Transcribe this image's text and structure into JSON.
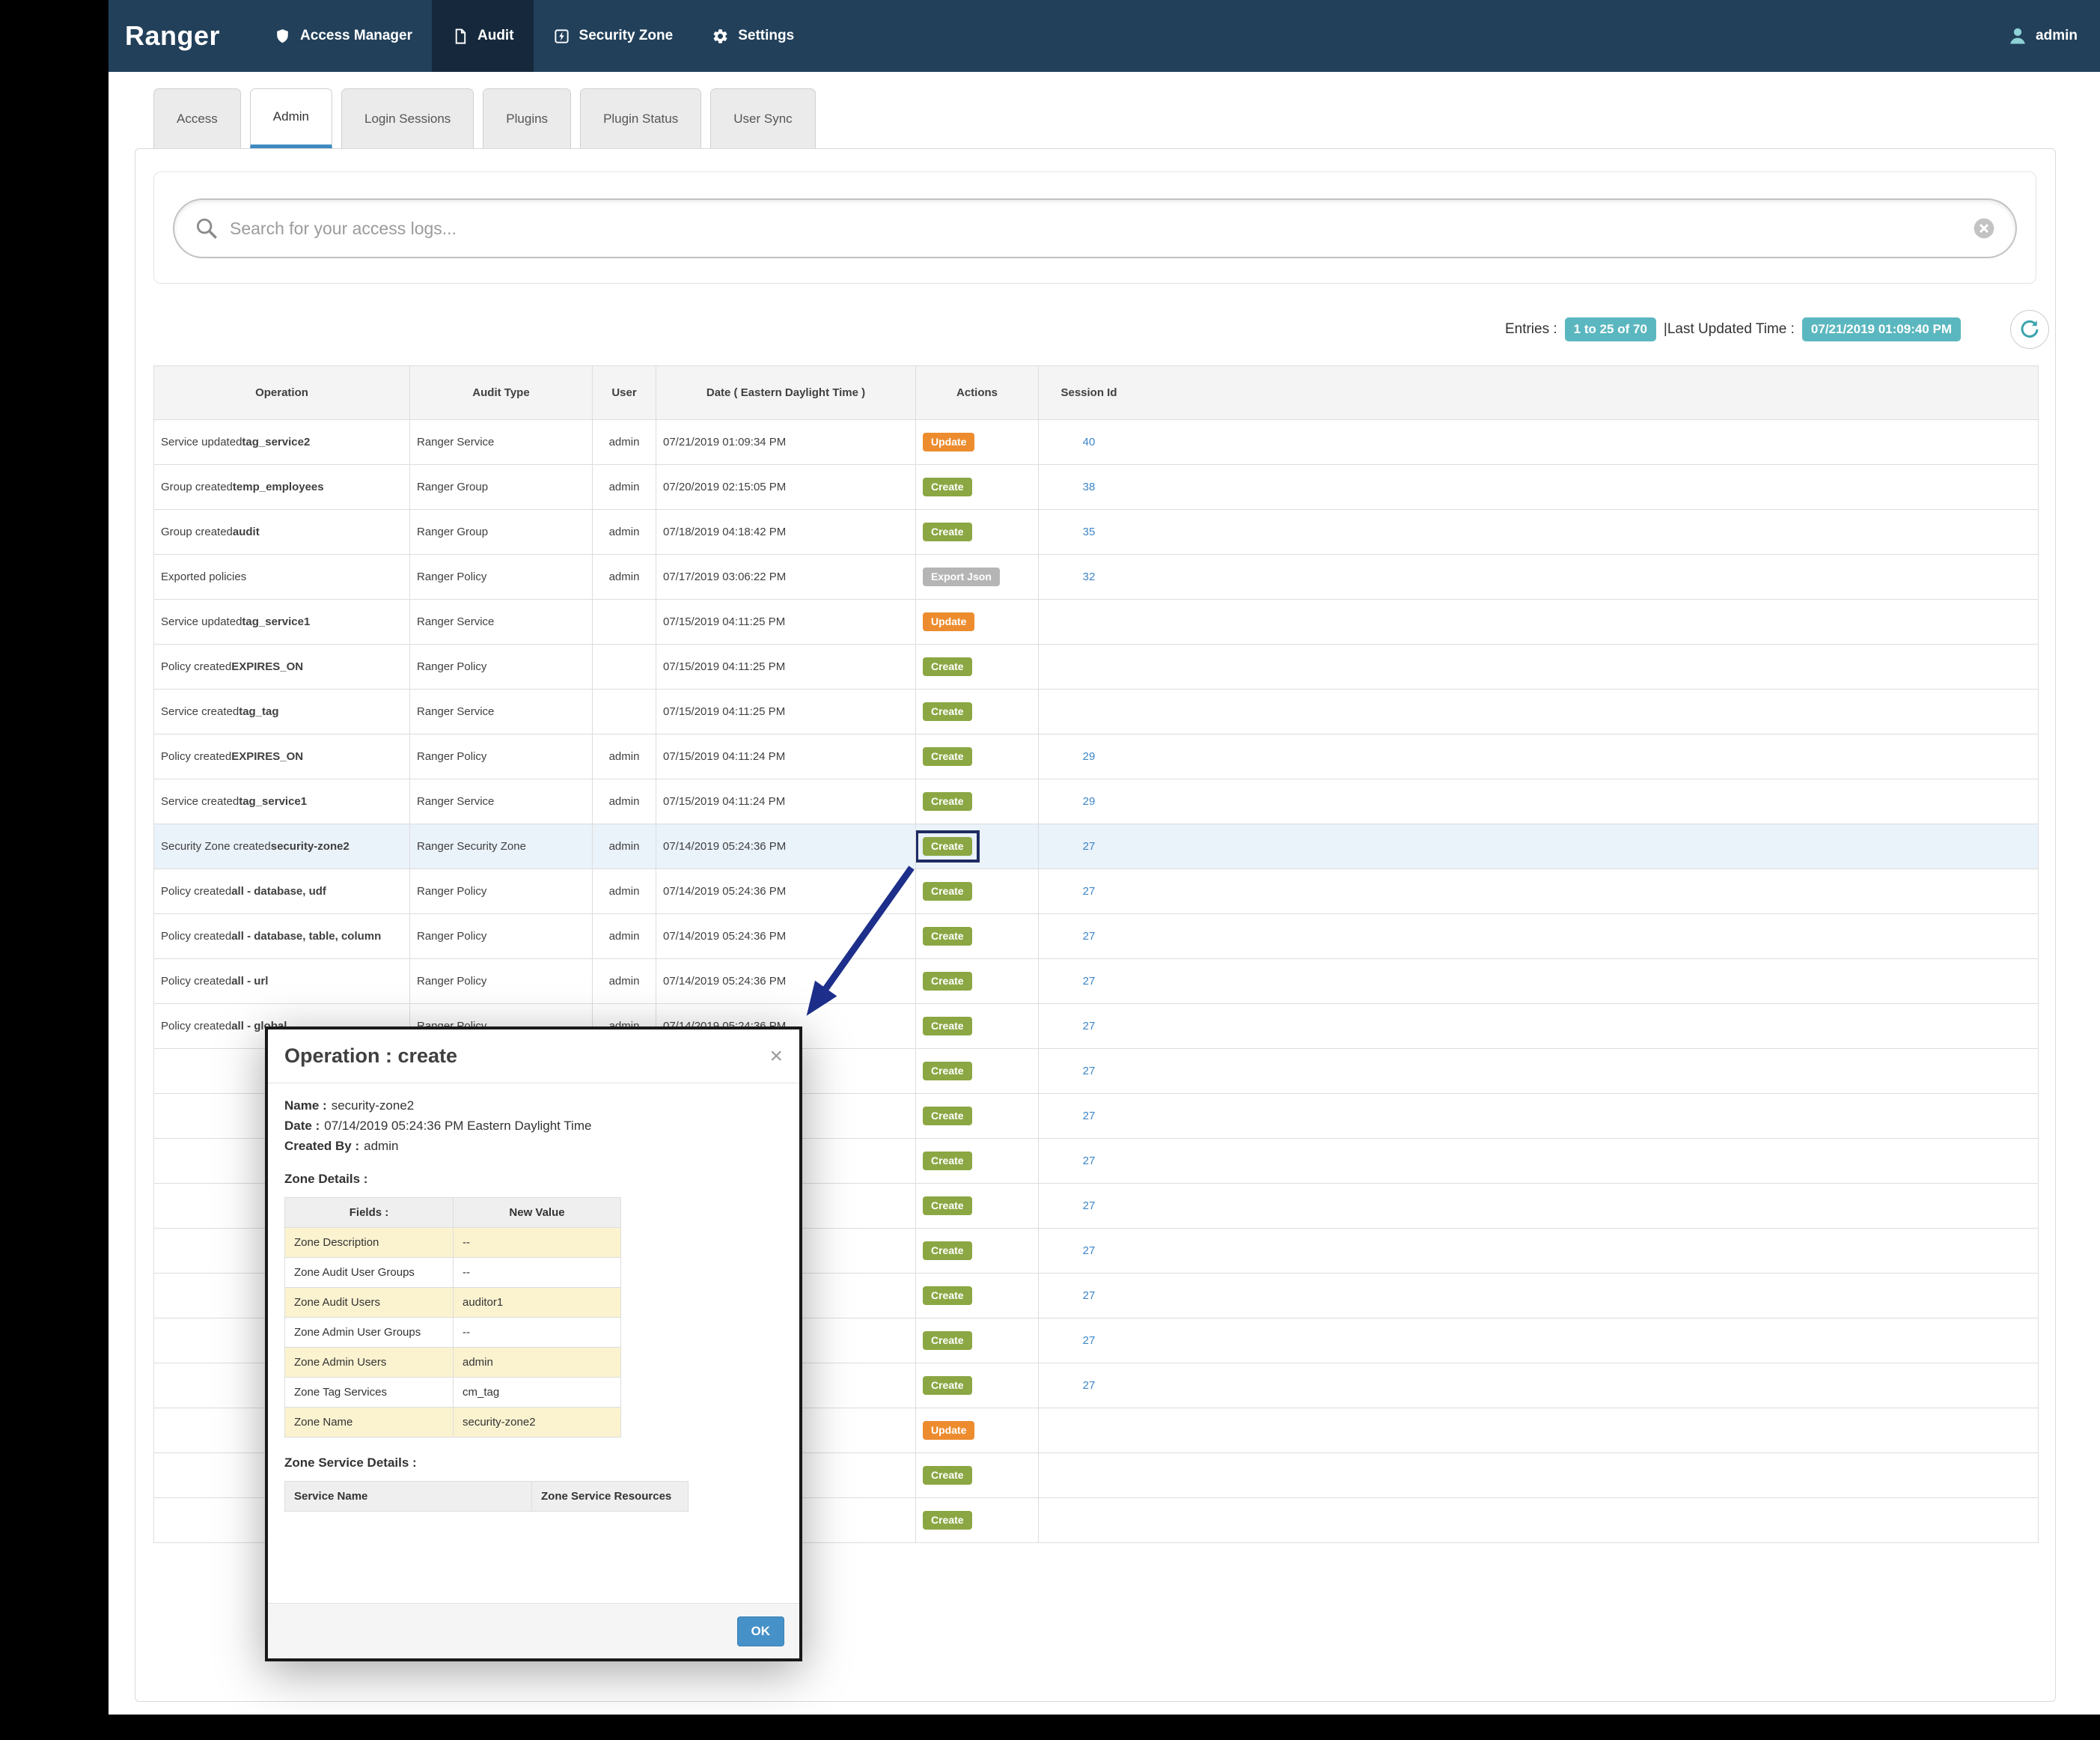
{
  "navbar": {
    "brand": "Ranger",
    "items": [
      {
        "id": "access-manager",
        "label": "Access Manager",
        "icon": "shield-icon",
        "active": false
      },
      {
        "id": "audit",
        "label": "Audit",
        "icon": "file-icon",
        "active": true
      },
      {
        "id": "security-zone",
        "label": "Security Zone",
        "icon": "zone-icon",
        "active": false
      },
      {
        "id": "settings",
        "label": "Settings",
        "icon": "gear-icon",
        "active": false
      }
    ],
    "user": {
      "label": "admin",
      "icon": "user-icon"
    }
  },
  "tabs": [
    {
      "id": "access",
      "label": "Access",
      "active": false
    },
    {
      "id": "admin",
      "label": "Admin",
      "active": true
    },
    {
      "id": "login-sessions",
      "label": "Login Sessions",
      "active": false
    },
    {
      "id": "plugins",
      "label": "Plugins",
      "active": false
    },
    {
      "id": "plugin-status",
      "label": "Plugin Status",
      "active": false
    },
    {
      "id": "user-sync",
      "label": "User Sync",
      "active": false
    }
  ],
  "search": {
    "placeholder": "Search for your access logs..."
  },
  "summary": {
    "entries_label": "Entries :",
    "entries_value": "1 to 25 of 70",
    "updated_label": "|Last Updated Time :",
    "updated_value": "07/21/2019 01:09:40 PM"
  },
  "table": {
    "headers": [
      "Operation",
      "Audit Type",
      "User",
      "Date ( Eastern Daylight Time )",
      "Actions",
      "Session Id"
    ],
    "rows": [
      {
        "op_prefix": "Service updated ",
        "op_bold": "tag_service2",
        "audit_type": "Ranger Service",
        "user": "admin",
        "date": "07/21/2019 01:09:34 PM",
        "action": "Update",
        "action_type": "update",
        "session": "40"
      },
      {
        "op_prefix": "Group created ",
        "op_bold": "temp_employees",
        "audit_type": "Ranger Group",
        "user": "admin",
        "date": "07/20/2019 02:15:05 PM",
        "action": "Create",
        "action_type": "create",
        "session": "38"
      },
      {
        "op_prefix": "Group created ",
        "op_bold": "audit",
        "audit_type": "Ranger Group",
        "user": "admin",
        "date": "07/18/2019 04:18:42 PM",
        "action": "Create",
        "action_type": "create",
        "session": "35"
      },
      {
        "op_prefix": "Exported policies",
        "op_bold": "",
        "audit_type": "Ranger Policy",
        "user": "admin",
        "date": "07/17/2019 03:06:22 PM",
        "action": "Export Json",
        "action_type": "export",
        "session": "32"
      },
      {
        "op_prefix": "Service updated ",
        "op_bold": "tag_service1",
        "audit_type": "Ranger Service",
        "user": "",
        "date": "07/15/2019 04:11:25 PM",
        "action": "Update",
        "action_type": "update",
        "session": ""
      },
      {
        "op_prefix": "Policy created ",
        "op_bold": "EXPIRES_ON",
        "audit_type": "Ranger Policy",
        "user": "",
        "date": "07/15/2019 04:11:25 PM",
        "action": "Create",
        "action_type": "create",
        "session": ""
      },
      {
        "op_prefix": "Service created ",
        "op_bold": "tag_tag",
        "audit_type": "Ranger Service",
        "user": "",
        "date": "07/15/2019 04:11:25 PM",
        "action": "Create",
        "action_type": "create",
        "session": ""
      },
      {
        "op_prefix": "Policy created ",
        "op_bold": "EXPIRES_ON",
        "audit_type": "Ranger Policy",
        "user": "admin",
        "date": "07/15/2019 04:11:24 PM",
        "action": "Create",
        "action_type": "create",
        "session": "29"
      },
      {
        "op_prefix": "Service created ",
        "op_bold": "tag_service1",
        "audit_type": "Ranger Service",
        "user": "admin",
        "date": "07/15/2019 04:11:24 PM",
        "action": "Create",
        "action_type": "create",
        "session": "29"
      },
      {
        "op_prefix": "Security Zone created ",
        "op_bold": "security-zone2",
        "audit_type": "Ranger Security Zone",
        "user": "admin",
        "date": "07/14/2019 05:24:36 PM",
        "action": "Create",
        "action_type": "create",
        "session": "27",
        "highlight": true,
        "boxed": true
      },
      {
        "op_prefix": "Policy created ",
        "op_bold": "all - database, udf",
        "audit_type": "Ranger Policy",
        "user": "admin",
        "date": "07/14/2019 05:24:36 PM",
        "action": "Create",
        "action_type": "create",
        "session": "27"
      },
      {
        "op_prefix": "Policy created ",
        "op_bold": "all - database, table, column",
        "audit_type": "Ranger Policy",
        "user": "admin",
        "date": "07/14/2019 05:24:36 PM",
        "action": "Create",
        "action_type": "create",
        "session": "27"
      },
      {
        "op_prefix": "Policy created ",
        "op_bold": "all - url",
        "audit_type": "Ranger Policy",
        "user": "admin",
        "date": "07/14/2019 05:24:36 PM",
        "action": "Create",
        "action_type": "create",
        "session": "27"
      },
      {
        "op_prefix": "Policy created ",
        "op_bold": "all - global",
        "audit_type": "Ranger Policy",
        "user": "admin",
        "date": "07/14/2019 05:24:36 PM",
        "action": "Create",
        "action_type": "create",
        "session": "27"
      },
      {
        "op_prefix": "",
        "op_bold": "",
        "audit_type": "",
        "user": "",
        "date": "",
        "action": "Create",
        "action_type": "create",
        "session": "27"
      },
      {
        "op_prefix": "",
        "op_bold": "",
        "audit_type": "",
        "user": "",
        "date": "",
        "action": "Create",
        "action_type": "create",
        "session": "27"
      },
      {
        "op_prefix": "",
        "op_bold": "",
        "audit_type": "",
        "user": "",
        "date": "",
        "action": "Create",
        "action_type": "create",
        "session": "27"
      },
      {
        "op_prefix": "",
        "op_bold": "",
        "audit_type": "",
        "user": "",
        "date": "",
        "action": "Create",
        "action_type": "create",
        "session": "27"
      },
      {
        "op_prefix": "",
        "op_bold": "",
        "audit_type": "",
        "user": "",
        "date": "",
        "action": "Create",
        "action_type": "create",
        "session": "27"
      },
      {
        "op_prefix": "",
        "op_bold": "",
        "audit_type": "",
        "user": "",
        "date": "",
        "action": "Create",
        "action_type": "create",
        "session": "27"
      },
      {
        "op_prefix": "",
        "op_bold": "",
        "audit_type": "",
        "user": "",
        "date": "",
        "action": "Create",
        "action_type": "create",
        "session": "27"
      },
      {
        "op_prefix": "",
        "op_bold": "",
        "audit_type": "",
        "user": "",
        "date": "",
        "action": "Create",
        "action_type": "create",
        "session": "27"
      },
      {
        "op_prefix": "",
        "op_bold": "",
        "audit_type": "",
        "user": "",
        "date": "",
        "action": "Update",
        "action_type": "update",
        "session": ""
      },
      {
        "op_prefix": "",
        "op_bold": "",
        "audit_type": "",
        "user": "",
        "date": "",
        "action": "Create",
        "action_type": "create",
        "session": ""
      },
      {
        "op_prefix": "",
        "op_bold": "",
        "audit_type": "",
        "user": "",
        "date": "",
        "action": "Create",
        "action_type": "create",
        "session": ""
      }
    ]
  },
  "modal": {
    "title": "Operation : create",
    "close_glyph": "×",
    "meta": [
      {
        "label": "Name :",
        "value": "security-zone2"
      },
      {
        "label": "Date :",
        "value": "07/14/2019 05:24:36 PM Eastern Daylight Time"
      },
      {
        "label": "Created By :",
        "value": "admin"
      }
    ],
    "zone_details": {
      "heading": "Zone Details :",
      "headers": [
        "Fields :",
        "New Value"
      ],
      "rows": [
        [
          "Zone Description",
          "--"
        ],
        [
          "Zone Audit User Groups",
          "--"
        ],
        [
          "Zone Audit Users",
          "auditor1"
        ],
        [
          "Zone Admin User Groups",
          "--"
        ],
        [
          "Zone Admin Users",
          "admin"
        ],
        [
          "Zone Tag Services",
          "cm_tag"
        ],
        [
          "Zone Name",
          "security-zone2"
        ]
      ]
    },
    "zone_service_details": {
      "heading": "Zone Service Details :",
      "headers": [
        "Service Name",
        "Zone Service Resources"
      ]
    },
    "ok_label": "OK"
  },
  "colors": {
    "navbar_bg": "#22405a",
    "navbar_active_bg": "#16293c",
    "create_badge": "#8ba743",
    "update_badge": "#ed8c2e",
    "export_badge": "#b5b5b5",
    "teal_badge": "#5bb7bf",
    "link_blue": "#3d86c8",
    "tab_active_underline": "#3f8ac2",
    "row_highlight": "#eaf2fa",
    "highlight_box": "#1e2c62",
    "arrow_navy": "#1d2f8a",
    "warning_row_bg": "#fbf3d0",
    "ok_button": "#4691c8"
  }
}
